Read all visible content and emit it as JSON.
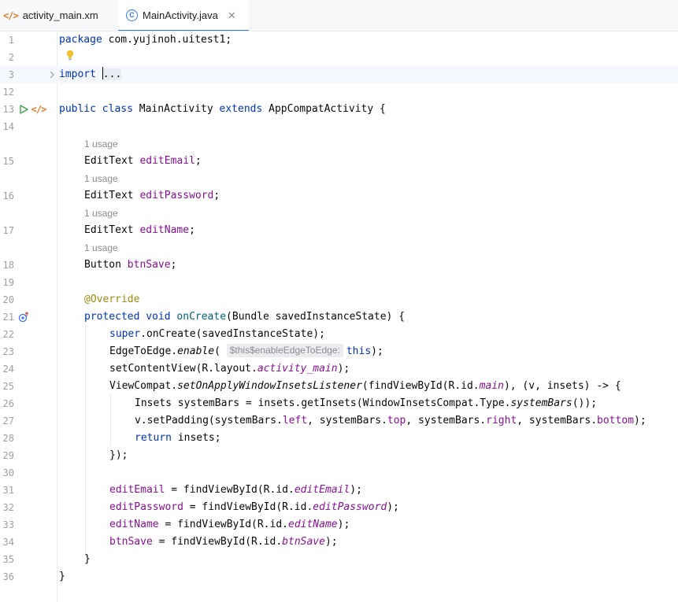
{
  "tabs": [
    {
      "label": "activity_main.xm",
      "icon": "xml-file-icon"
    },
    {
      "label": "MainActivity.java",
      "icon": "java-class-icon",
      "active": true
    }
  ],
  "usage_hint": "1 usage",
  "param_hint": "$this$enableEdgeToEdge:",
  "lines": {
    "l1": "1",
    "l2": "2",
    "l3": "3",
    "l12": "12",
    "l13": "13",
    "l14": "14",
    "l15": "15",
    "l16": "16",
    "l17": "17",
    "l18": "18",
    "l19": "19",
    "l20": "20",
    "l21": "21",
    "l22": "22",
    "l23": "23",
    "l24": "24",
    "l25": "25",
    "l26": "26",
    "l27": "27",
    "l28": "28",
    "l29": "29",
    "l30": "30",
    "l31": "31",
    "l32": "32",
    "l33": "33",
    "l34": "34",
    "l35": "35",
    "l36": "36"
  },
  "code": {
    "package_kw": "package",
    "package_name": " com.yujinoh.uitest1;",
    "import_kw": "import",
    "import_folded": "...",
    "l13_public": "public",
    "l13_class": "class",
    "l13_name": " MainActivity ",
    "l13_extends": "extends",
    "l13_rest": " AppCompatActivity {",
    "f1_type": "EditText ",
    "f1_name": "editEmail",
    "f2_type": "EditText ",
    "f2_name": "editPassword",
    "f3_type": "EditText ",
    "f3_name": "editName",
    "f4_type": "Button ",
    "f4_name": "btnSave",
    "semicolon": ";",
    "override": "@Override",
    "oc_protected": "protected",
    "oc_void": "void",
    "oc_name": "onCreate",
    "oc_params": "(Bundle savedInstanceState) {",
    "l22_super": "super",
    "l22_rest": ".onCreate(savedInstanceState);",
    "l23_a": "EdgeToEdge.",
    "l23_m": "enable",
    "l23_b": "( ",
    "l23_this": "this",
    "l23_c": ");",
    "l24_a": "setContentView(R.layout.",
    "l24_f": "activity_main",
    "l24_b": ");",
    "l25_a": "ViewCompat.",
    "l25_m": "setOnApplyWindowInsetsListener",
    "l25_b": "(findViewById(R.id.",
    "l25_f": "main",
    "l25_c": "), (v, insets) -> {",
    "l26_a": "Insets systemBars = insets.getInsets(WindowInsetsCompat.Type.",
    "l26_m": "systemBars",
    "l26_b": "());",
    "l27_a": "v.setPadding(systemBars.",
    "l27_f1": "left",
    "l27_s1": ", systemBars.",
    "l27_f2": "top",
    "l27_s2": ", systemBars.",
    "l27_f3": "right",
    "l27_s3": ", systemBars.",
    "l27_f4": "bottom",
    "l27_b": ");",
    "l28_return": "return",
    "l28_rest": " insets;",
    "l29": "});",
    "a1_f": "editEmail",
    "a1_a": " = findViewById(R.id.",
    "a1_id": "editEmail",
    "a2_f": "editPassword",
    "a2_a": " = findViewById(R.id.",
    "a2_id": "editPassword",
    "a3_f": "editName",
    "a3_a": " = findViewById(R.id.",
    "a3_id": "editName",
    "a4_f": "btnSave",
    "a4_a": " = findViewById(R.id.",
    "a4_id": "btnSave",
    "close_paren": ");",
    "brace_close": "}"
  },
  "colors": {
    "keyword": "#0033b3",
    "field": "#871094",
    "method": "#00627a",
    "annotation": "#9e880d",
    "line_number": "#9aa0a6",
    "current_line": "#f5f8fe",
    "active_tab_underline": "#3574f0"
  },
  "gutter_icons": [
    "lightbulb-icon",
    "fold-chevron-icon",
    "run-icon",
    "xml-link-icon",
    "override-method-icon"
  ]
}
